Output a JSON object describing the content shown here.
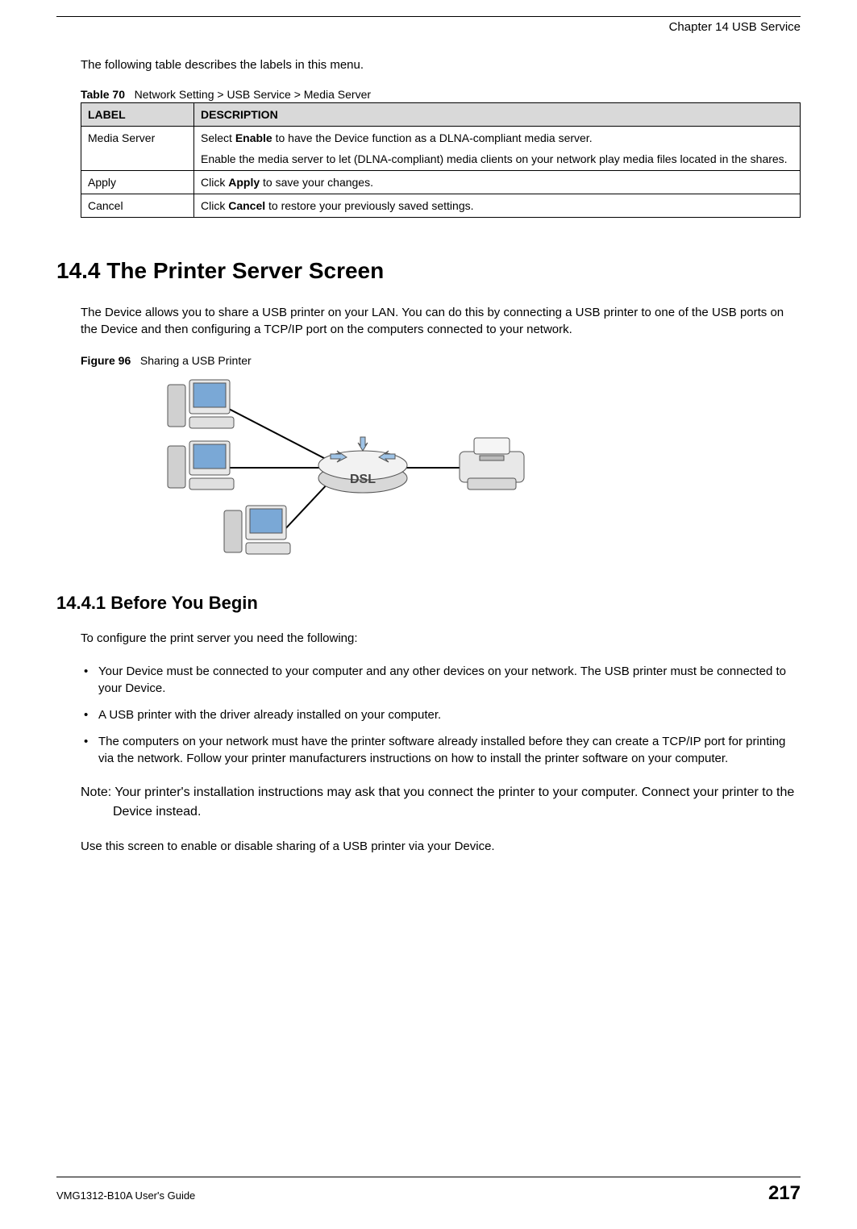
{
  "header": {
    "chapter": "Chapter 14 USB Service"
  },
  "intro": "The following table describes the labels in this menu.",
  "table": {
    "caption_label": "Table 70",
    "caption_text": "Network Setting > USB Service > Media Server",
    "head": {
      "label": "LABEL",
      "description": "DESCRIPTION"
    },
    "rows": [
      {
        "label": "Media Server",
        "desc_p1_pre": "Select ",
        "desc_p1_bold": "Enable",
        "desc_p1_post": " to have the Device function as a DLNA-compliant media server.",
        "desc_p2": "Enable the media server to let (DLNA-compliant) media clients on your network play media files located in the shares."
      },
      {
        "label": "Apply",
        "desc_p1_pre": "Click ",
        "desc_p1_bold": "Apply",
        "desc_p1_post": " to save your changes."
      },
      {
        "label": "Cancel",
        "desc_p1_pre": "Click ",
        "desc_p1_bold": "Cancel",
        "desc_p1_post": " to restore your previously saved settings."
      }
    ]
  },
  "section": {
    "number_title": "14.4  The Printer Server Screen",
    "para": "The Device allows you to share a USB printer on your LAN. You can do this by connecting a USB printer to one of the USB ports on the Device and then configuring a TCP/IP port on the computers connected to your network."
  },
  "figure": {
    "caption_label": "Figure 96",
    "caption_text": "Sharing a USB Printer",
    "router_label": "DSL"
  },
  "subsection": {
    "number_title": "14.4.1  Before You Begin",
    "intro": "To configure the print server you need the following:",
    "bullets": [
      "Your Device must be connected to your computer and any other devices on your network. The USB printer must be connected to your Device.",
      "A USB printer with the driver already installed on your computer.",
      "The computers on your network must have the printer software already installed before they can create a TCP/IP port for printing via the network. Follow your printer manufacturers instructions on how to install the printer software on your computer."
    ],
    "note": "Note: Your printer's installation instructions may ask that you connect the printer to your computer. Connect your printer to the Device instead.",
    "closing": "Use this screen to enable or disable sharing of a USB printer via your Device."
  },
  "footer": {
    "guide": "VMG1312-B10A User's Guide",
    "page": "217"
  }
}
